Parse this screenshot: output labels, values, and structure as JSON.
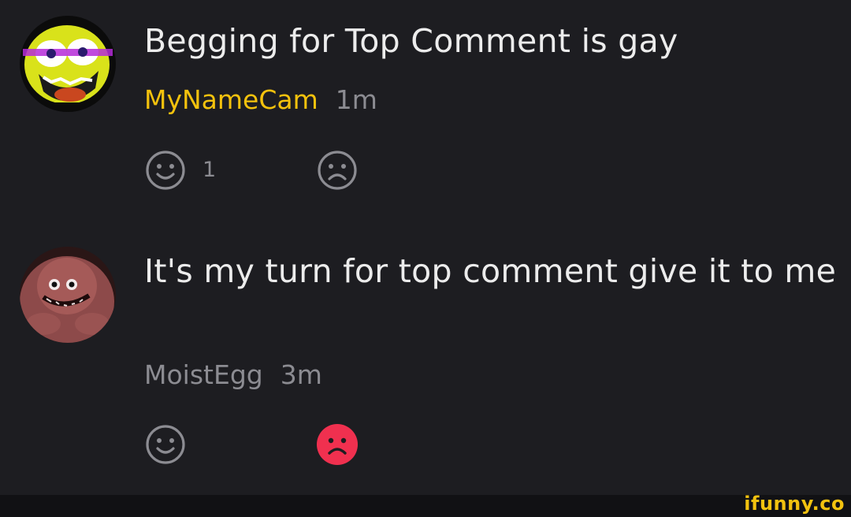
{
  "comments": [
    {
      "text": "Begging for Top Comment is gay",
      "username": "MyNameCam",
      "time": "1m",
      "like_count": "1",
      "username_color": "#f4c20d",
      "dislike_active": false
    },
    {
      "text": "It's my turn for top comment give it to me",
      "username": "MoistEgg",
      "time": "3m",
      "like_count": "",
      "username_color": "#8c8c92",
      "dislike_active": true
    }
  ],
  "icons": {
    "like": "smile-icon",
    "dislike": "frown-icon"
  },
  "colors": {
    "background": "#1d1d21",
    "text": "#ececec",
    "muted": "#8c8c92",
    "accent_username": "#f4c20d",
    "dislike_active": "#f0304f"
  },
  "watermark": "ifunny.co"
}
